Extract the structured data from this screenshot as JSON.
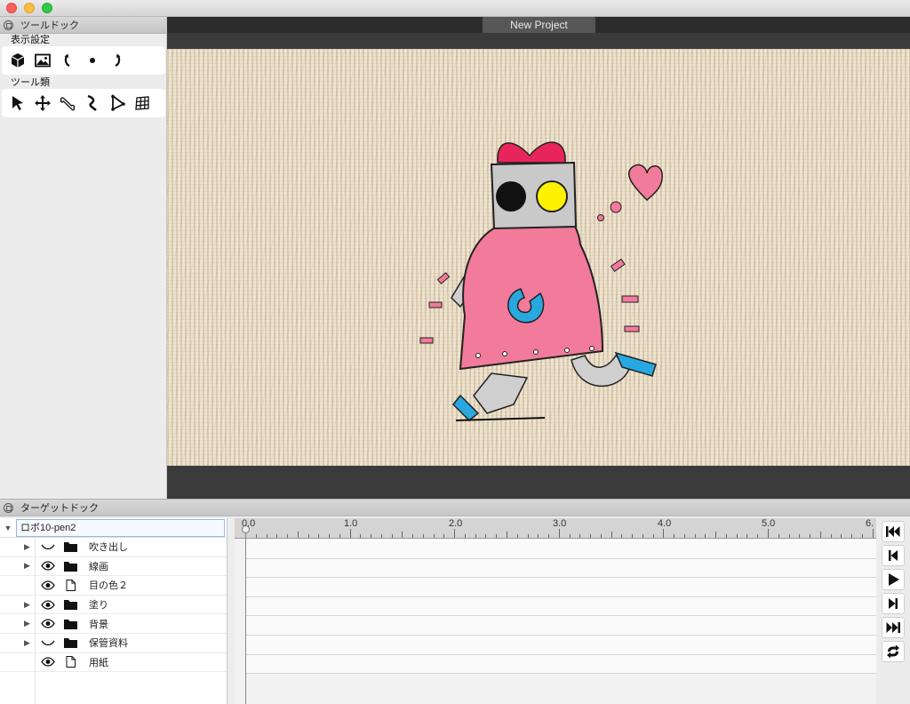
{
  "window": {
    "tab_title": "New Project"
  },
  "tool_dock": {
    "title": "ツールドック",
    "display_section": "表示設定",
    "display_tools": [
      "3d-box-icon",
      "image-icon",
      "rotate-left-icon",
      "dot-icon",
      "rotate-right-icon"
    ],
    "tools_section": "ツール類",
    "tools": [
      "arrow-cursor-icon",
      "move-icon",
      "bone-icon",
      "curve-icon",
      "polygon-icon",
      "mesh-grid-icon"
    ]
  },
  "target_dock": {
    "title": "ターゲットドック",
    "root_layer": "ロボ10-pen2",
    "layers": [
      {
        "name": "吹き出し",
        "expandable": true,
        "visible": false,
        "type": "folder"
      },
      {
        "name": "線画",
        "expandable": true,
        "visible": true,
        "type": "folder"
      },
      {
        "name": "目の色２",
        "expandable": false,
        "visible": true,
        "type": "file"
      },
      {
        "name": "塗り",
        "expandable": true,
        "visible": true,
        "type": "folder"
      },
      {
        "name": "背景",
        "expandable": true,
        "visible": true,
        "type": "folder"
      },
      {
        "name": "保管資料",
        "expandable": true,
        "visible": false,
        "type": "folder"
      },
      {
        "name": "用紙",
        "expandable": false,
        "visible": true,
        "type": "file"
      }
    ]
  },
  "timeline": {
    "ruler_labels": [
      "0.0",
      "1.0",
      "2.0",
      "3.0",
      "4.0",
      "5.0",
      "6."
    ]
  },
  "colors": {
    "canvas_bg": "#3b3b3b",
    "robot_pink": "#f27a9b",
    "robot_blue": "#29a8e0",
    "bow_red": "#e8255a",
    "eye_yellow": "#fff200"
  }
}
